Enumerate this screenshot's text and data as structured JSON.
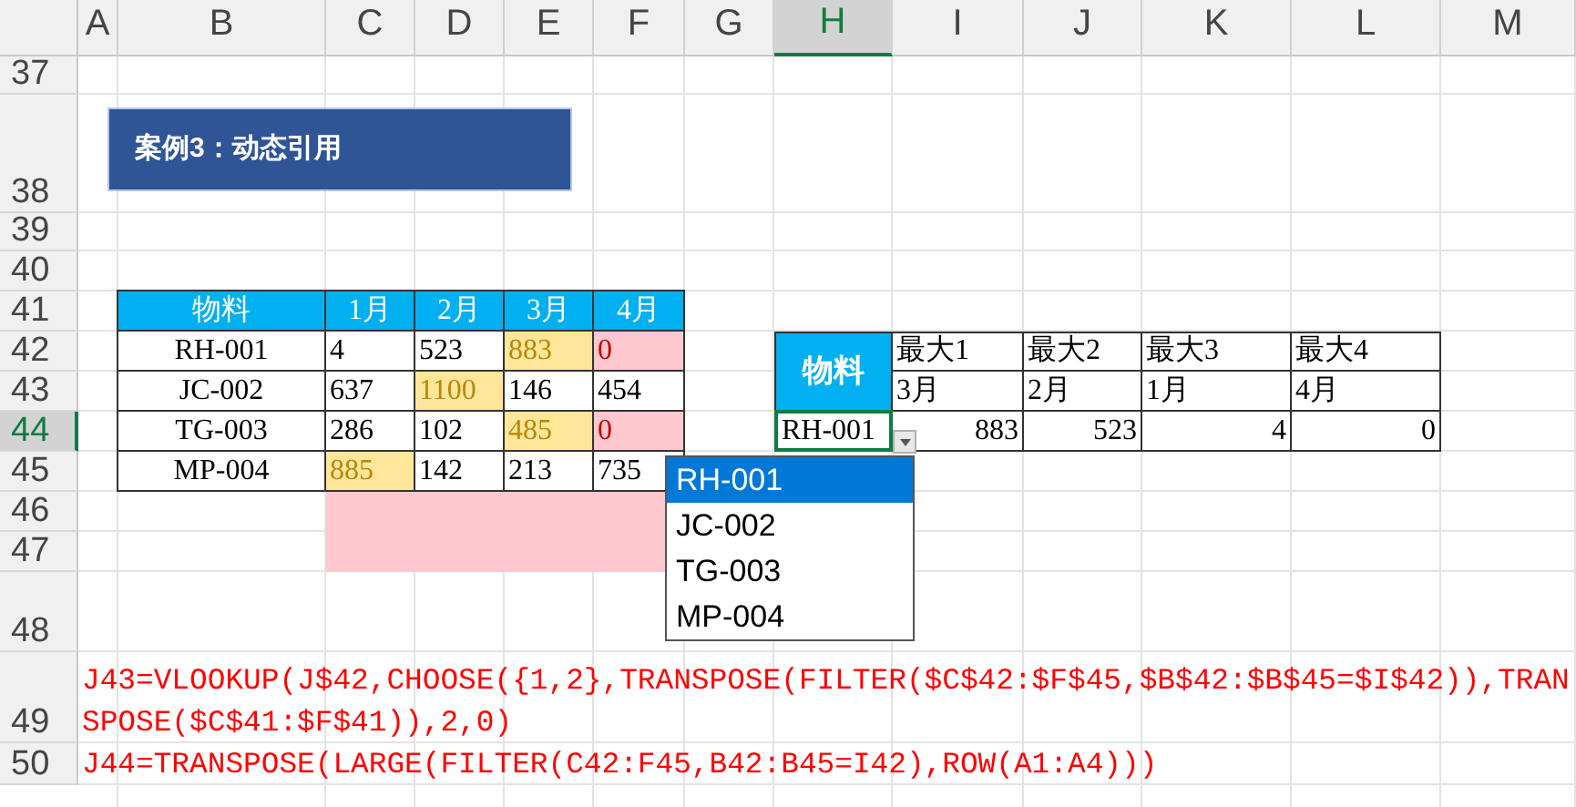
{
  "column_headers": [
    {
      "label": "A",
      "selected": false
    },
    {
      "label": "B",
      "selected": false
    },
    {
      "label": "C",
      "selected": false
    },
    {
      "label": "D",
      "selected": false
    },
    {
      "label": "E",
      "selected": false
    },
    {
      "label": "F",
      "selected": false
    },
    {
      "label": "G",
      "selected": false
    },
    {
      "label": "H",
      "selected": true
    },
    {
      "label": "I",
      "selected": false
    },
    {
      "label": "J",
      "selected": false
    },
    {
      "label": "K",
      "selected": false
    },
    {
      "label": "L",
      "selected": false
    },
    {
      "label": "M",
      "selected": false
    }
  ],
  "row_headers": [
    {
      "label": "37",
      "selected": false
    },
    {
      "label": "38",
      "selected": false
    },
    {
      "label": "39",
      "selected": false
    },
    {
      "label": "40",
      "selected": false
    },
    {
      "label": "41",
      "selected": false
    },
    {
      "label": "42",
      "selected": false
    },
    {
      "label": "43",
      "selected": false
    },
    {
      "label": "44",
      "selected": true
    },
    {
      "label": "45",
      "selected": false
    },
    {
      "label": "46",
      "selected": false
    },
    {
      "label": "47",
      "selected": false
    },
    {
      "label": "48",
      "selected": false
    },
    {
      "label": "49",
      "selected": false
    },
    {
      "label": "50",
      "selected": false
    }
  ],
  "title_shape": {
    "text": "案例3：动态引用"
  },
  "source_table": {
    "columns": [
      "物料",
      "1月",
      "2月",
      "3月",
      "4月"
    ],
    "rows": [
      {
        "cells": [
          {
            "text": "RH-001",
            "kind": "normal"
          },
          {
            "text": "4",
            "kind": "normal"
          },
          {
            "text": "523",
            "kind": "normal"
          },
          {
            "text": "883",
            "kind": "high"
          },
          {
            "text": "0",
            "kind": "low"
          }
        ]
      },
      {
        "cells": [
          {
            "text": "JC-002",
            "kind": "normal"
          },
          {
            "text": "637",
            "kind": "normal"
          },
          {
            "text": "1100",
            "kind": "high"
          },
          {
            "text": "146",
            "kind": "normal"
          },
          {
            "text": "454",
            "kind": "normal"
          }
        ]
      },
      {
        "cells": [
          {
            "text": "TG-003",
            "kind": "normal"
          },
          {
            "text": "286",
            "kind": "normal"
          },
          {
            "text": "102",
            "kind": "normal"
          },
          {
            "text": "485",
            "kind": "high"
          },
          {
            "text": "0",
            "kind": "low"
          }
        ]
      },
      {
        "cells": [
          {
            "text": "MP-004",
            "kind": "normal"
          },
          {
            "text": "885",
            "kind": "high"
          },
          {
            "text": "142",
            "kind": "normal"
          },
          {
            "text": "213",
            "kind": "normal"
          },
          {
            "text": "735",
            "kind": "normal"
          }
        ]
      }
    ]
  },
  "lookup_table": {
    "header": "物料",
    "material": "RH-001",
    "material_selected": true,
    "columns": [
      {
        "title": "最大1",
        "month": "3月",
        "value": "883"
      },
      {
        "title": "最大2",
        "month": "2月",
        "value": "523"
      },
      {
        "title": "最大3",
        "month": "1月",
        "value": "4"
      },
      {
        "title": "最大4",
        "month": "4月",
        "value": "0"
      }
    ]
  },
  "dropdown": {
    "items": [
      {
        "label": "RH-001",
        "selected": true
      },
      {
        "label": "JC-002",
        "selected": false
      },
      {
        "label": "TG-003",
        "selected": false
      },
      {
        "label": "MP-004",
        "selected": false
      }
    ]
  },
  "formulas": [
    "J43=VLOOKUP(J$42,CHOOSE({1,2},TRANSPOSE(FILTER($C$42:$F$45,$B$42:$B$45=$I$42)),TRANSPOSE($C$41:$F$41)),2,0)",
    "J44=TRANSPOSE(LARGE(FILTER(C42:F45,B42:B45=I42),ROW(A1:A4)))"
  ]
}
